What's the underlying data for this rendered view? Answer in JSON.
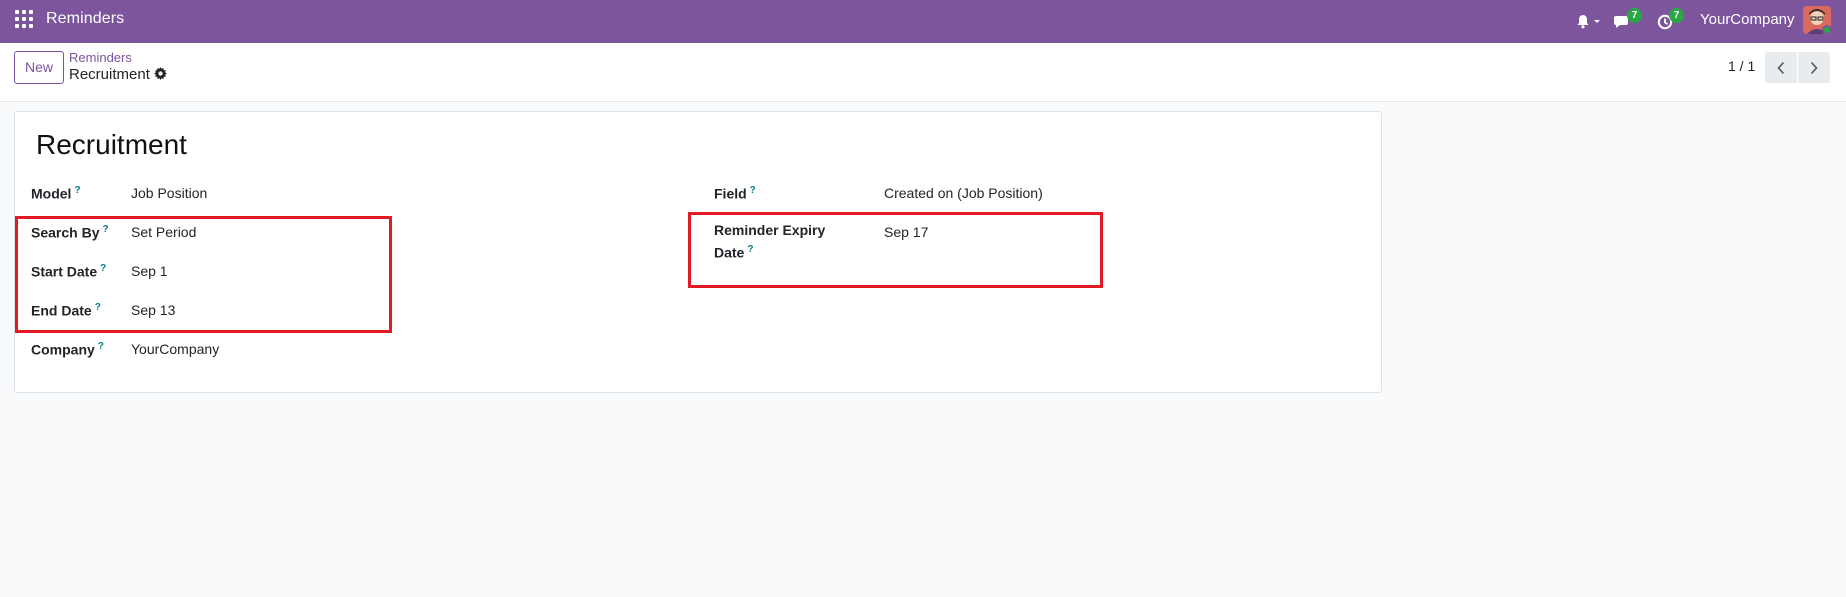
{
  "navbar": {
    "app_title": "Reminders",
    "messages_badge": "7",
    "activities_badge": "7",
    "company": "YourCompany",
    "bg_color": "#7c559d"
  },
  "control_panel": {
    "new_label": "New",
    "breadcrumb_parent": "Reminders",
    "breadcrumb_current": "Recruitment",
    "pager": "1 / 1"
  },
  "form": {
    "title": "Recruitment",
    "help_mark": "?",
    "left_fields": [
      {
        "label": "Model",
        "value": "Job Position"
      },
      {
        "label": "Search By",
        "value": "Set Period"
      },
      {
        "label": "Start Date",
        "value": "Sep 1"
      },
      {
        "label": "End Date",
        "value": "Sep 13"
      },
      {
        "label": "Company",
        "value": "YourCompany"
      }
    ],
    "right_fields": [
      {
        "label": "Field",
        "value": "Created on (Job Position)"
      },
      {
        "label_line1": "Reminder Expiry",
        "label_line2": "Date",
        "value": "Sep 17"
      }
    ]
  },
  "icons": {
    "apps": "apps-grid-icon",
    "bell": "bell-icon",
    "messages": "chat-icon",
    "activities": "clock-icon",
    "settings": "gear-icon",
    "prev": "chevron-left-icon",
    "next": "chevron-right-icon"
  },
  "highlight_color": "#e11a24"
}
